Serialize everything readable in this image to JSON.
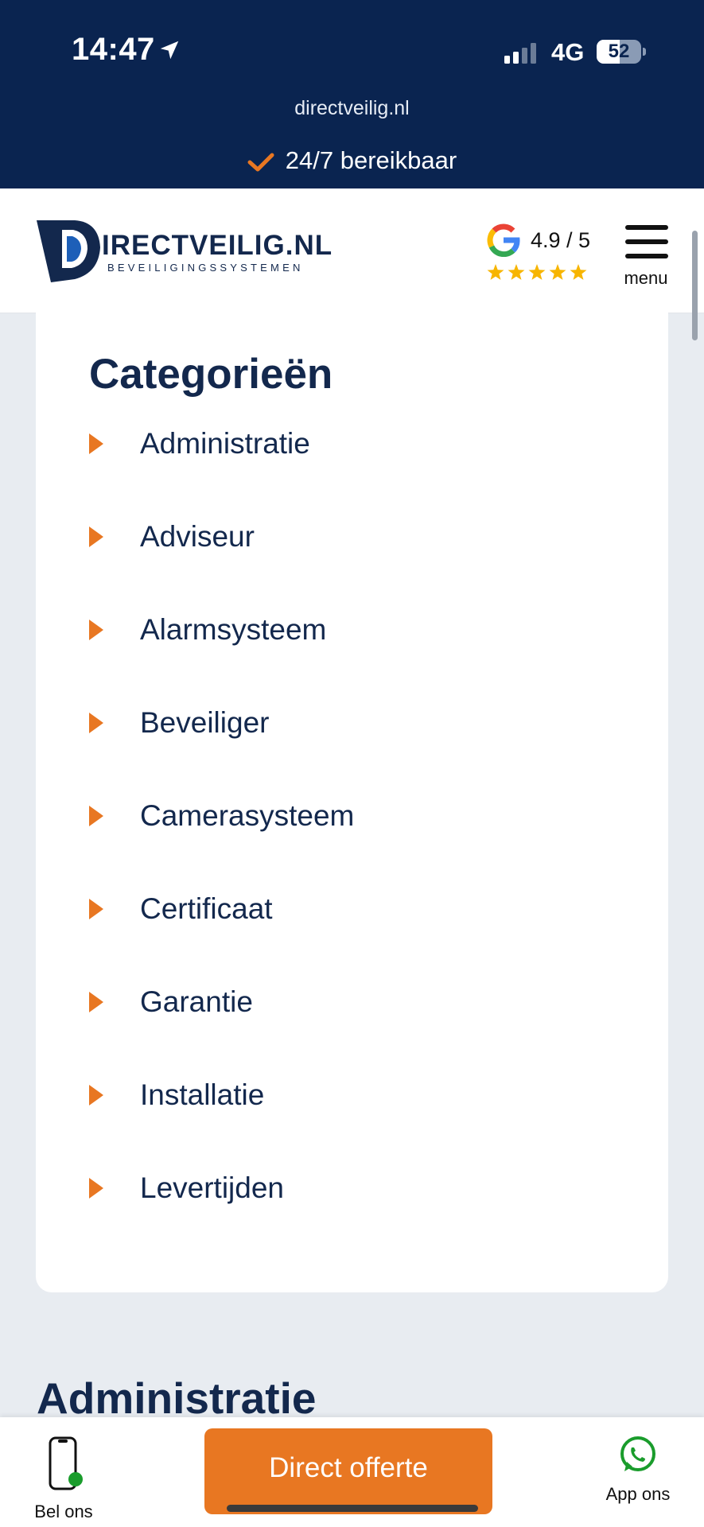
{
  "status_bar": {
    "time": "14:47",
    "network": "4G",
    "battery": "52",
    "battery_level": 0.52,
    "location_icon": "location-arrow-icon",
    "signal_icon": "signal-bars-icon"
  },
  "banner": {
    "url": "directveilig.nl",
    "availability": "24/7 bereikbaar",
    "check_icon": "check-icon"
  },
  "header": {
    "logo_text": "IRECTVEILIG.NL",
    "logo_subtitle": "BEVEILIGINGSSYSTEMEN",
    "rating": "4.9 / 5",
    "stars": 5,
    "menu_label": "menu"
  },
  "categories": {
    "title": "Categorieën",
    "items": [
      {
        "label": "Administratie"
      },
      {
        "label": "Adviseur"
      },
      {
        "label": "Alarmsysteem"
      },
      {
        "label": "Beveiliger"
      },
      {
        "label": "Camerasysteem"
      },
      {
        "label": "Certificaat"
      },
      {
        "label": "Garantie"
      },
      {
        "label": "Installatie"
      },
      {
        "label": "Levertijden"
      }
    ]
  },
  "section": {
    "heading": "Administratie"
  },
  "bottom_bar": {
    "call_label": "Bel ons",
    "cta_label": "Direct offerte",
    "app_label": "App ons"
  },
  "colors": {
    "navy": "#0a2450",
    "text_navy": "#13284d",
    "accent_orange": "#e87722",
    "whatsapp_green": "#1a9c2c",
    "star_yellow": "#f7b500",
    "page_bg": "#e8ecf1"
  }
}
